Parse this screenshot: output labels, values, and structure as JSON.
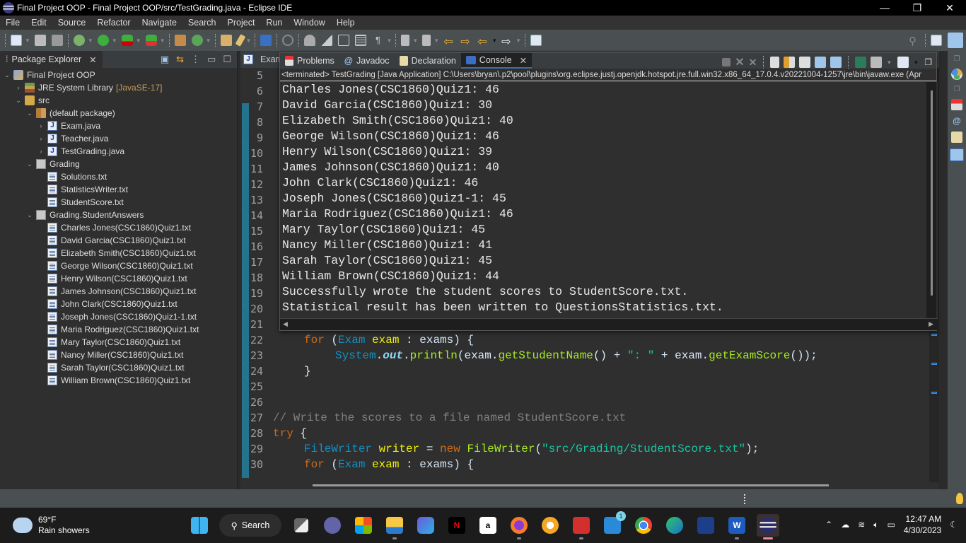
{
  "window": {
    "title": "Final Project OOP - Final Project OOP/src/TestGrading.java - Eclipse IDE",
    "controls": {
      "minimize": "—",
      "restore": "❐",
      "close": "✕"
    }
  },
  "menu": [
    "File",
    "Edit",
    "Source",
    "Refactor",
    "Navigate",
    "Search",
    "Project",
    "Run",
    "Window",
    "Help"
  ],
  "package_explorer": {
    "tab_label": "Package Explorer",
    "project": "Final Project OOP",
    "jre": {
      "label": "JRE System Library",
      "suffix": "[JavaSE-17]"
    },
    "src": "src",
    "default_package": "(default package)",
    "java_files": [
      "Exam.java",
      "Teacher.java",
      "TestGrading.java"
    ],
    "grading_package": "Grading",
    "grading_files": [
      "Solutions.txt",
      "StatisticsWriter.txt",
      "StudentScore.txt"
    ],
    "answers_package": "Grading.StudentAnswers",
    "answer_files": [
      "Charles Jones(CSC1860)Quiz1.txt",
      "David Garcia(CSC1860)Quiz1.txt",
      "Elizabeth Smith(CSC1860)Quiz1.txt",
      "George Wilson(CSC1860)Quiz1.txt",
      "Henry Wilson(CSC1860)Quiz1.txt",
      "James Johnson(CSC1860)Quiz1.txt",
      "John Clark(CSC1860)Quiz1.txt",
      "Joseph Jones(CSC1860)Quiz1-1.txt",
      "Maria Rodriguez(CSC1860)Quiz1.txt",
      "Mary Taylor(CSC1860)Quiz1.txt",
      "Nancy Miller(CSC1860)Quiz1.txt",
      "Sarah Taylor(CSC1860)Quiz1.txt",
      "William Brown(CSC1860)Quiz1.txt"
    ]
  },
  "editor": {
    "tab_label": "Exam",
    "line_numbers": [
      "5",
      "6",
      "7",
      "8",
      "9",
      "10",
      "11",
      "12",
      "13",
      "14",
      "15",
      "16",
      "17",
      "18",
      "19",
      "20",
      "21",
      "22",
      "23",
      "24",
      "25",
      "26",
      "27",
      "28",
      "29",
      "30"
    ],
    "code": {
      "l22": {
        "kw": "for",
        "p1": " (",
        "ty": "Exam",
        "sp": " ",
        "var": "exam",
        "rest": " : exams) {"
      },
      "l23": {
        "ty": "System",
        "dot1": ".",
        "fld": "out",
        "dot2": ".",
        "m1": "println",
        "a": "(exam.",
        "m2": "getStudentName",
        "b": "() + ",
        "str": "\": \"",
        "c": " + exam.",
        "m3": "getExamScore",
        "d": "());"
      },
      "l24": "}",
      "l27": "// Write the scores to a file named StudentScore.txt",
      "l28": {
        "kw": "try",
        "rest": " {"
      },
      "l29": {
        "ty": "FileWriter",
        "sp": " ",
        "var": "writer",
        "eq": " = ",
        "kw": "new",
        "sp2": " ",
        "m": "FileWriter",
        "p": "(",
        "str": "\"src/Grading/StudentScore.txt\"",
        "end": ");"
      },
      "l30": {
        "kw": "for",
        "p1": " (",
        "ty": "Exam",
        "sp": " ",
        "var": "exam",
        "rest": " : exams) {"
      }
    }
  },
  "console": {
    "tabs": [
      "Problems",
      "Javadoc",
      "Declaration",
      "Console"
    ],
    "active_tab": "Console",
    "status": "<terminated> TestGrading [Java Application] C:\\Users\\bryan\\.p2\\pool\\plugins\\org.eclipse.justj.openjdk.hotspot.jre.full.win32.x86_64_17.0.4.v20221004-1257\\jre\\bin\\javaw.exe  (Apr",
    "output": [
      "Charles Jones(CSC1860)Quiz1: 46",
      "David Garcia(CSC1860)Quiz1: 30",
      "Elizabeth Smith(CSC1860)Quiz1: 40",
      "George Wilson(CSC1860)Quiz1: 46",
      "Henry Wilson(CSC1860)Quiz1: 39",
      "James Johnson(CSC1860)Quiz1: 40",
      "John Clark(CSC1860)Quiz1: 46",
      "Joseph Jones(CSC1860)Quiz1-1: 45",
      "Maria Rodriguez(CSC1860)Quiz1: 46",
      "Mary Taylor(CSC1860)Quiz1: 45",
      "Nancy Miller(CSC1860)Quiz1: 41",
      "Sarah Taylor(CSC1860)Quiz1: 45",
      "William Brown(CSC1860)Quiz1: 44",
      "Successfully wrote the student scores to StudentScore.txt.",
      "Statistical result has been written to QuestionsStatistics.txt."
    ]
  },
  "taskbar": {
    "weather": {
      "temp": "69°F",
      "desc": "Rain showers"
    },
    "search_label": "Search",
    "mail_badge": "1",
    "clock": {
      "time": "12:47 AM",
      "date": "4/30/2023"
    }
  },
  "colors": {
    "accent": "#3b6fa6",
    "keyword": "#cc6c1d",
    "type": "#1290c3",
    "string": "#17c6a3",
    "method": "#a7ec21",
    "variable": "#f2f200"
  }
}
